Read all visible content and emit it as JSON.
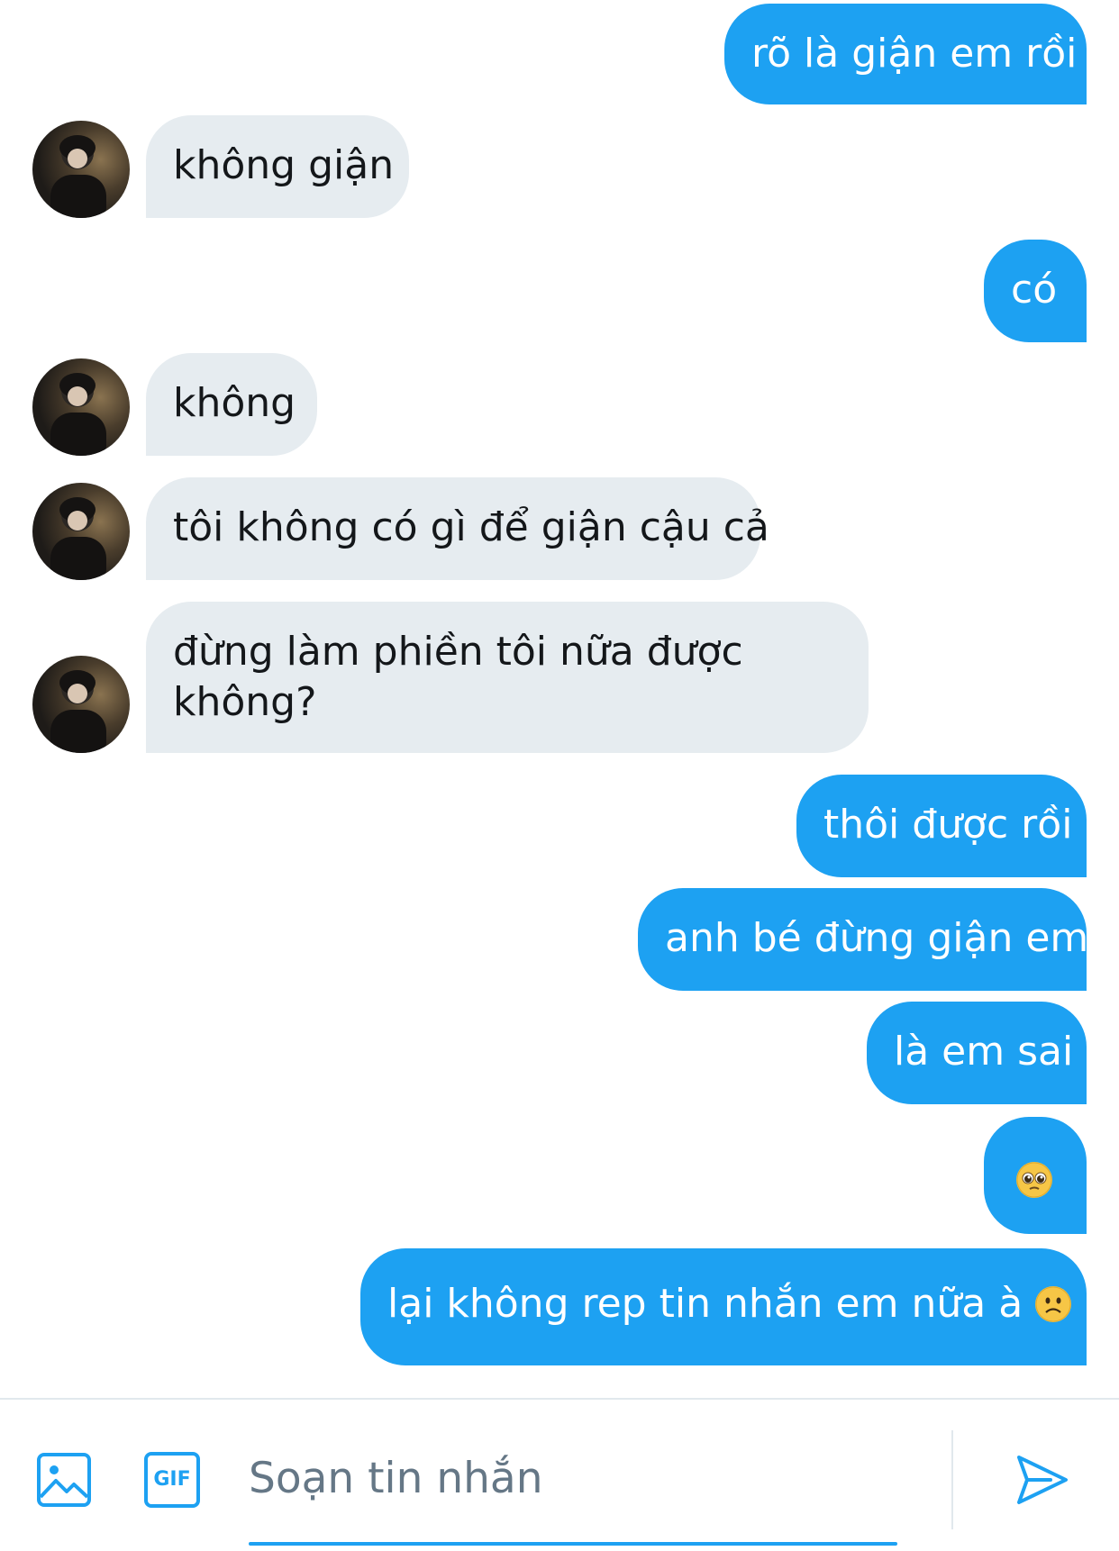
{
  "messages": [
    {
      "side": "out",
      "text": "rõ là giận em rồi"
    },
    {
      "side": "in",
      "text": "không giận"
    },
    {
      "side": "out",
      "text": "có"
    },
    {
      "side": "in",
      "text": "không"
    },
    {
      "side": "in",
      "text": "tôi không có gì để giận cậu cả"
    },
    {
      "side": "in",
      "line1": "đừng làm phiền tôi nữa được",
      "line2": "không?"
    },
    {
      "side": "out",
      "text": "thôi được rồi"
    },
    {
      "side": "out",
      "text": "anh bé đừng giận em"
    },
    {
      "side": "out",
      "text": "là em sai"
    },
    {
      "side": "out",
      "emoji": "pleading-face-emoji"
    },
    {
      "side": "out",
      "text_before": "lại không rep tin nhắn em nữa à ",
      "emoji": "slightly-frowning-face-emoji",
      "text_after": " ?"
    }
  ],
  "composer": {
    "image_icon": "image-icon",
    "gif_label": "GIF",
    "placeholder": "Soạn tin nhắn",
    "send_icon": "send-icon"
  },
  "colors": {
    "outgoing_bubble": "#1da1f2",
    "incoming_bubble": "#e6ecf0",
    "accent": "#1da1f2",
    "placeholder_text": "#657786"
  }
}
